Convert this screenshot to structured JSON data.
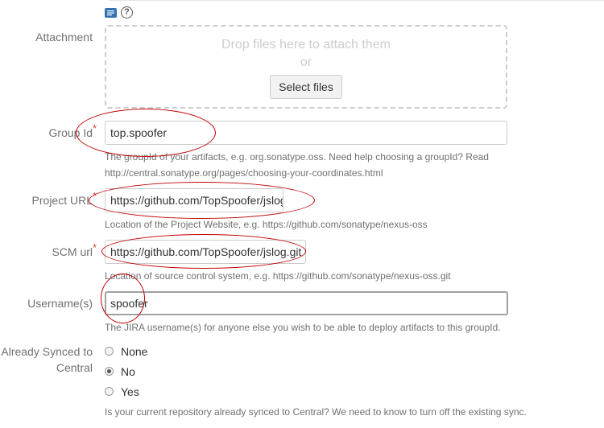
{
  "toolbar": {
    "editor_icon": "editor-icon",
    "help_icon": "help-icon"
  },
  "attachment": {
    "label": "Attachment",
    "drop_text": "Drop files here to attach them",
    "or_text": "or",
    "button_label": "Select files"
  },
  "group_id": {
    "label": "Group Id",
    "required_mark": "*",
    "value": "top.spoofer",
    "help_line1": "The groupId of your artifacts, e.g. org.sonatype.oss. Need help choosing a groupId? Read",
    "help_line2": "http://central.sonatype.org/pages/choosing-your-coordinates.html"
  },
  "project_url": {
    "label": "Project URL",
    "required_mark": "*",
    "value": "https://github.com/TopSpoofer/jslog",
    "help": "Location of the Project Website, e.g. https://github.com/sonatype/nexus-oss"
  },
  "scm_url": {
    "label": "SCM url",
    "required_mark": "*",
    "value": "https://github.com/TopSpoofer/jslog.git",
    "help": "Location of source control system, e.g. https://github.com/sonatype/nexus-oss.git"
  },
  "usernames": {
    "label": "Username(s)",
    "value": "spoofer",
    "help": "The JIRA username(s) for anyone else you wish to be able to deploy artifacts to this groupId."
  },
  "already_synced": {
    "label_line1": "Already Synced to",
    "label_line2": "Central",
    "options": [
      "None",
      "No",
      "Yes"
    ],
    "selected": "No",
    "help": "Is your current repository already synced to Central? We need to know to turn off the existing sync."
  },
  "colors": {
    "annotation": "#c00000",
    "required": "#d04437",
    "muted_text": "#707070"
  }
}
